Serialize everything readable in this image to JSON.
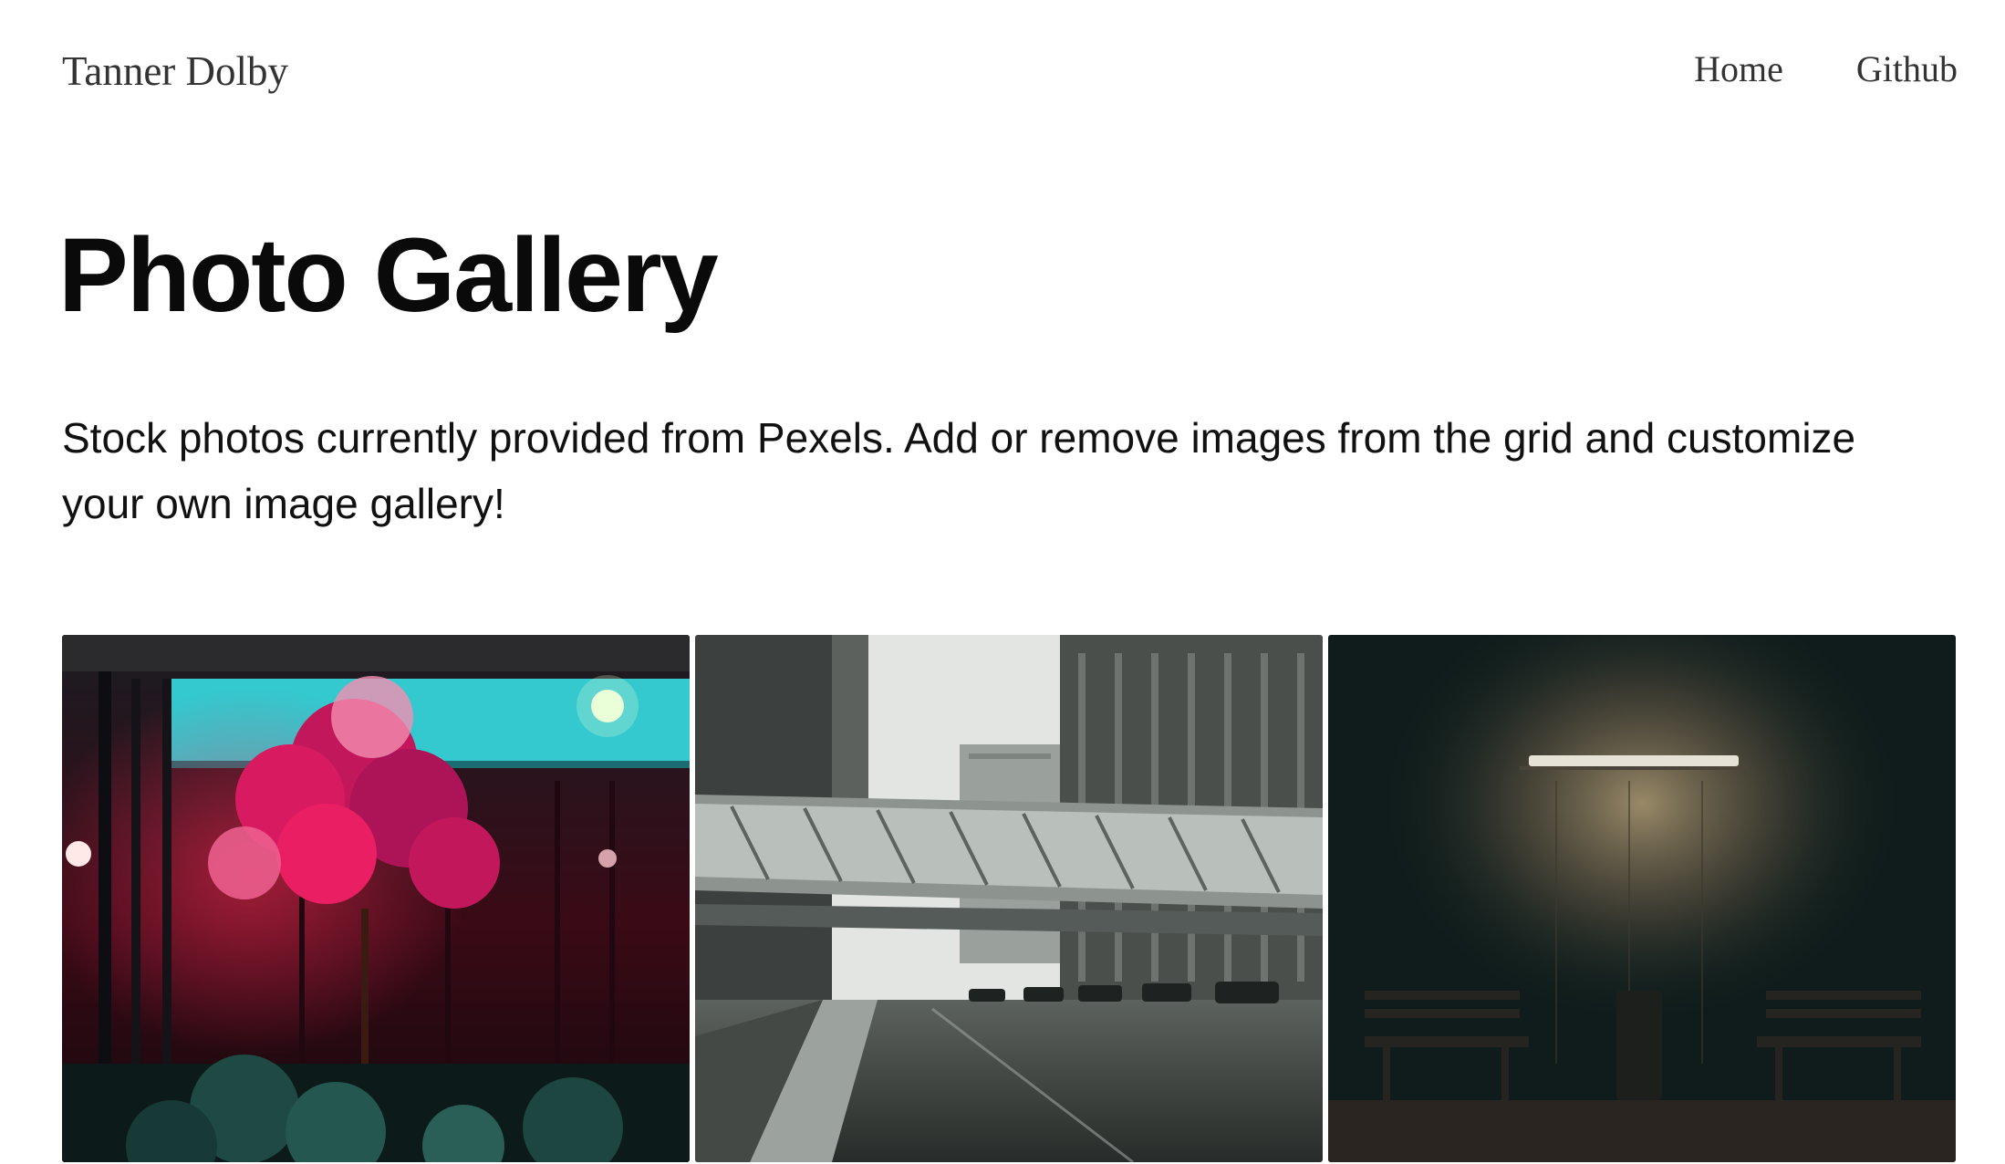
{
  "header": {
    "brand": "Tanner Dolby",
    "nav": [
      {
        "label": "Home"
      },
      {
        "label": "Github"
      }
    ]
  },
  "main": {
    "title": "Photo Gallery",
    "description": "Stock photos currently provided from Pexels. Add or remove images from the grid and customize your own image gallery!"
  },
  "gallery": {
    "photos": [
      {
        "subject": "neon storefront with red maple tree at night",
        "accent": "#c2185b"
      },
      {
        "subject": "rainy city street with skybridge between buildings",
        "accent": "#7d8580"
      },
      {
        "subject": "dark wall lit by a single lamp above two benches",
        "accent": "#8a7a5c"
      }
    ]
  }
}
